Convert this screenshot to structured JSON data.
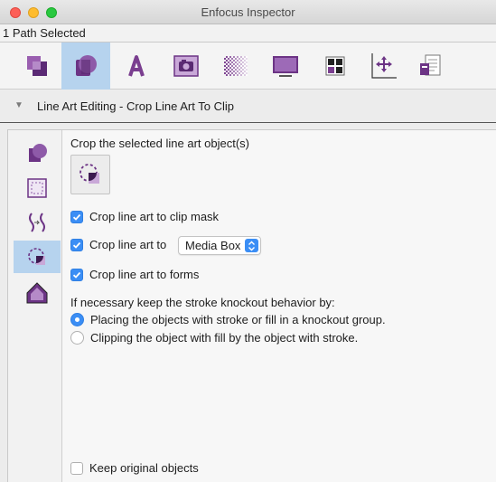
{
  "window": {
    "title": "Enfocus Inspector"
  },
  "selection": {
    "text": "1 Path Selected"
  },
  "toolbar": {
    "tools": [
      {
        "icon": "object-shapes-icon"
      },
      {
        "icon": "line-art-editing-icon",
        "active": true
      },
      {
        "icon": "text-icon"
      },
      {
        "icon": "image-camera-icon"
      },
      {
        "icon": "gradient-pattern-icon"
      },
      {
        "icon": "monitor-icon"
      },
      {
        "icon": "color-swatches-icon"
      },
      {
        "icon": "position-axes-icon"
      },
      {
        "icon": "document-info-icon"
      }
    ]
  },
  "section": {
    "title": "Line Art Editing - Crop Line Art To Clip"
  },
  "sidebar": {
    "items": [
      {
        "icon": "shape-union-icon"
      },
      {
        "icon": "bounding-box-icon"
      },
      {
        "icon": "path-join-icon"
      },
      {
        "icon": "crop-to-clip-icon",
        "active": true
      },
      {
        "icon": "house-shape-icon"
      }
    ]
  },
  "content": {
    "heading": "Crop the selected line art object(s)",
    "options": {
      "clip_mask": {
        "label": "Crop line art to clip mask",
        "checked": true
      },
      "crop_to": {
        "label": "Crop line art to",
        "checked": true
      },
      "forms": {
        "label": "Crop line art to forms",
        "checked": true
      }
    },
    "crop_select": {
      "value": "Media Box"
    },
    "stroke_heading": "If necessary keep the stroke knockout behavior by:",
    "radios": [
      {
        "label": "Placing the objects with stroke or fill in a knockout group.",
        "selected": true
      },
      {
        "label": "Clipping the object with fill by the object with stroke.",
        "selected": false
      }
    ],
    "keep_original": {
      "label": "Keep original objects",
      "checked": false
    }
  },
  "colors": {
    "accent": "#3b8ef5",
    "active_bg": "#b6d3ee",
    "icon_purple": "#7a3e8f"
  }
}
